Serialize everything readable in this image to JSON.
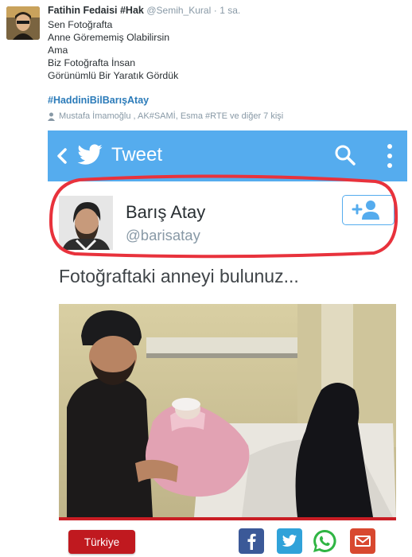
{
  "tweet": {
    "author_name": "Fatihin Fedaisi #Hak",
    "author_handle": "@Semih_Kural",
    "separator": "·",
    "time": "1 sa.",
    "lines": [
      "Sen Fotoğrafta",
      "Anne Görememiş Olabilirsin",
      "Ama",
      "Biz Fotoğrafta İnsan",
      "Görünümlü Bir Yaratık Gördük"
    ],
    "hashtag": "#HaddiniBilBarışAtay",
    "retweeted_by": "Mustafa İmamoğlu , AK#SAMİ, Esma #RTE ve diğer 7 kişi"
  },
  "embedded": {
    "app_bar": {
      "title": "Tweet",
      "color": "#55acee",
      "icons": [
        "back-arrow-icon",
        "twitter-bird-icon",
        "search-icon",
        "more-vertical-icon"
      ]
    },
    "profile": {
      "name": "Barış Atay",
      "handle": "@barisatay",
      "follow_icon": "follow-user-icon"
    },
    "caption": "Fotoğraftaki anneyi bulunuz...",
    "share": {
      "category": "Türkiye",
      "icons": [
        "facebook-icon",
        "twitter-icon",
        "whatsapp-icon",
        "mail-icon"
      ]
    },
    "highlight_color": "#e8323c"
  }
}
